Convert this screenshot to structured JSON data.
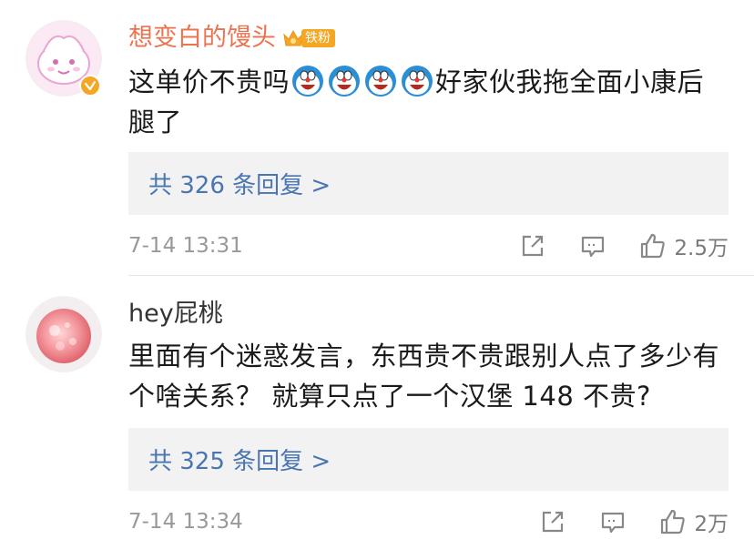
{
  "comments": [
    {
      "username": "想变白的馒头",
      "fan_badge": "铁粉",
      "text_before": "这单价不贵吗",
      "emoji": "doraemon-laugh-emoji",
      "emoji_count": 4,
      "text_after": "好家伙我拖全面小康后腿了",
      "replies": "共 326 条回复 >",
      "time": "7-14 13:31",
      "likes": "2.5万"
    },
    {
      "username": "hey屁桃",
      "text": "里面有个迷惑发言，东西贵不贵跟别人点了多少有个啥关系？ 就算只点了一个汉堡 148 不贵?",
      "replies": "共 325 条回复 >",
      "time": "7-14 13:34",
      "likes": "2万"
    }
  ],
  "colors": {
    "vip_name": "#eb7350",
    "link": "#4a75b3",
    "meta": "#999999",
    "reply_bg": "#f2f2f2",
    "badge": "#f5a623"
  }
}
